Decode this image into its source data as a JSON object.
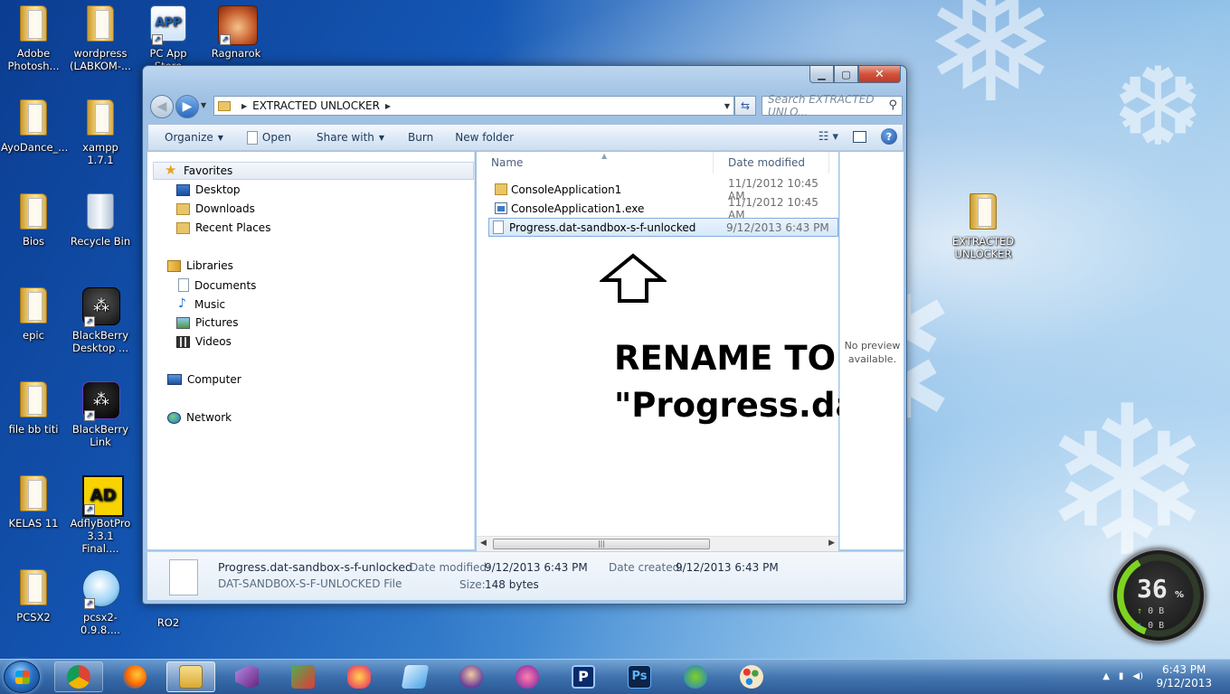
{
  "desktop": {
    "icons": [
      {
        "label": "Adobe\nPhotosh...",
        "kind": "folder"
      },
      {
        "label": "wordpress\n(LABKOM-...",
        "kind": "folder"
      },
      {
        "label": "PC App Store",
        "kind": "app"
      },
      {
        "label": "Ragnarok",
        "kind": "app"
      },
      {
        "label": "AyoDance_...",
        "kind": "folder"
      },
      {
        "label": "xampp 1.7.1",
        "kind": "folder"
      },
      {
        "label": "Bios",
        "kind": "folder"
      },
      {
        "label": "Recycle Bin",
        "kind": "recycle-bin"
      },
      {
        "label": "epic",
        "kind": "folder"
      },
      {
        "label": "BlackBerry\nDesktop ...",
        "kind": "app"
      },
      {
        "label": "file bb titi",
        "kind": "folder"
      },
      {
        "label": "BlackBerry\nLink",
        "kind": "app"
      },
      {
        "label": "KELAS 11",
        "kind": "folder"
      },
      {
        "label": "AdflyBotPro\n3.3.1 Final....",
        "kind": "app"
      },
      {
        "label": "PCSX2",
        "kind": "folder"
      },
      {
        "label": "pcsx2-0.9.8....",
        "kind": "app"
      },
      {
        "label": "RO2",
        "kind": "folder"
      },
      {
        "label": "EXTRACTED\nUNLOCKER",
        "kind": "folder"
      }
    ]
  },
  "explorer": {
    "breadcrumb": [
      "EXTRACTED UNLOCKER"
    ],
    "search_placeholder": "Search EXTRACTED UNLO...",
    "toolbar": {
      "organize": "Organize",
      "open": "Open",
      "share_with": "Share with",
      "burn": "Burn",
      "new_folder": "New folder"
    },
    "nav": {
      "favorites": "Favorites",
      "desktop": "Desktop",
      "downloads": "Downloads",
      "recent_places": "Recent Places",
      "libraries": "Libraries",
      "documents": "Documents",
      "music": "Music",
      "pictures": "Pictures",
      "videos": "Videos",
      "computer": "Computer",
      "network": "Network"
    },
    "columns": {
      "name": "Name",
      "date_modified": "Date modified"
    },
    "files": [
      {
        "name": "ConsoleApplication1",
        "date": "11/1/2012 10:45 AM",
        "type": "folder",
        "selected": false
      },
      {
        "name": "ConsoleApplication1.exe",
        "date": "11/1/2012 10:45 AM",
        "type": "exe",
        "selected": false
      },
      {
        "name": "Progress.dat-sandbox-s-f-unlocked",
        "date": "9/12/2013 6:43 PM",
        "type": "file",
        "selected": true
      }
    ],
    "annotation": {
      "line1": "RENAME TO",
      "line2": "\"Progress.dat\""
    },
    "preview": {
      "line1": "No preview",
      "line2": "available."
    },
    "details": {
      "file_name": "Progress.dat-sandbox-s-f-unlocked",
      "file_type": "DAT-SANDBOX-S-F-UNLOCKED File",
      "date_modified_label": "Date modified:",
      "date_modified": "9/12/2013 6:43 PM",
      "size_label": "Size:",
      "size": "148 bytes",
      "date_created_label": "Date created:",
      "date_created": "9/12/2013 6:43 PM"
    }
  },
  "gadget": {
    "percent": "36",
    "percent_sign": "%",
    "up": "0 B",
    "down": "0 B"
  },
  "taskbar": {
    "clock_time": "6:43 PM",
    "clock_date": "9/12/2013"
  }
}
